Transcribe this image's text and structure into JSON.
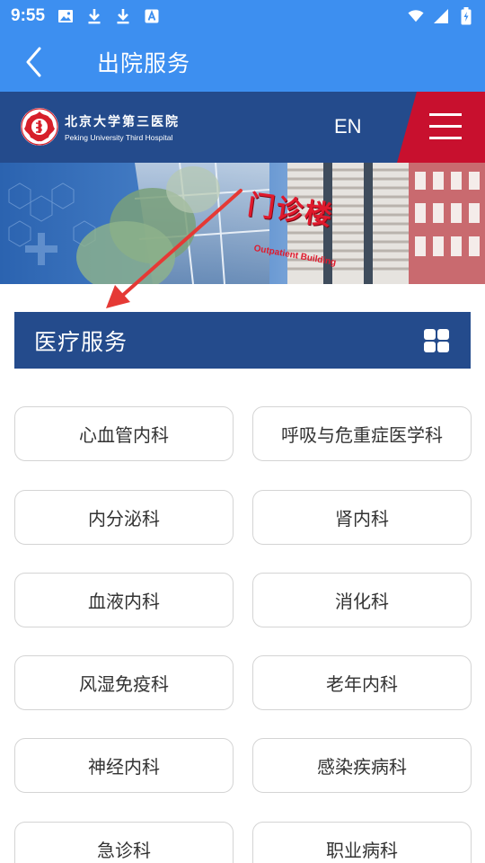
{
  "status_bar": {
    "time": "9:55",
    "left_icons": [
      "image-icon",
      "download-icon",
      "download-icon",
      "font-icon"
    ],
    "right_icons": [
      "wifi-icon",
      "signal-icon",
      "battery-icon"
    ]
  },
  "app_bar": {
    "back_icon": "chevron-left-icon",
    "title": "出院服务"
  },
  "header": {
    "logo_cn": "北京大学第三医院",
    "logo_en": "Peking University Third Hospital",
    "lang": "EN",
    "menu_icon": "hamburger-icon"
  },
  "banner": {
    "sign_cn": "门诊楼",
    "sign_en": "Outpatient Building"
  },
  "section": {
    "title": "医疗服务",
    "grid_icon": "grid-icon"
  },
  "departments": [
    [
      "心血管内科",
      "呼吸与危重症医学科"
    ],
    [
      "内分泌科",
      "肾内科"
    ],
    [
      "血液内科",
      "消化科"
    ],
    [
      "风湿免疫科",
      "老年内科"
    ],
    [
      "神经内科",
      "感染疾病科"
    ],
    [
      "急诊科",
      "职业病科"
    ]
  ],
  "colors": {
    "app_bar": "#3d8ff0",
    "header": "#244b8c",
    "accent_red": "#c8102e",
    "arrow": "#e53935"
  }
}
